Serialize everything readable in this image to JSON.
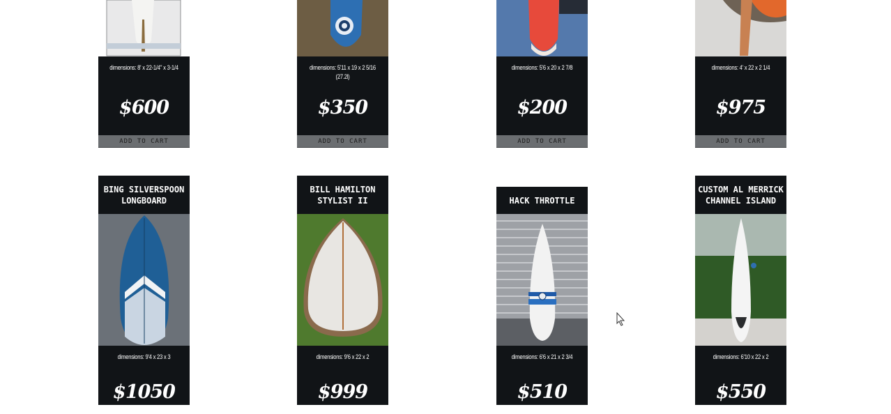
{
  "add_to_cart_label": "ADD TO CART",
  "top_row": [
    {
      "dimensions": "dimensions: 8' x 22-1/4\" x 3-1/4",
      "price": "$600"
    },
    {
      "dimensions": "dimensions: 5'11 x 19 x 2 5/16 (27.2l)",
      "price": "$350"
    },
    {
      "dimensions": "dimensions: 5'6 x 20 x 2 7/8",
      "price": "$200"
    },
    {
      "dimensions": "dimensions: 4' x 22 x 2 1/4",
      "price": "$975"
    }
  ],
  "bottom_row": [
    {
      "title": "BING SILVERSPOON LONGBOARD",
      "dimensions": "dimensions: 9'4 x 23 x 3",
      "price": "$1050"
    },
    {
      "title": "BILL HAMILTON STYLIST II",
      "dimensions": "dimensions: 9'6 x 22 x 2",
      "price": "$999"
    },
    {
      "title": "HACK THROTTLE",
      "dimensions": "dimensions: 6'6 x 21 x 2 3/4",
      "price": "$510"
    },
    {
      "title": "CUSTOM AL MERRICK CHANNEL ISLAND",
      "dimensions": "dimensions: 6'10 x 22 x 2",
      "price": "$550"
    }
  ],
  "colors": {
    "card_bg": "#111417",
    "cart_button": "#6b6e71"
  }
}
